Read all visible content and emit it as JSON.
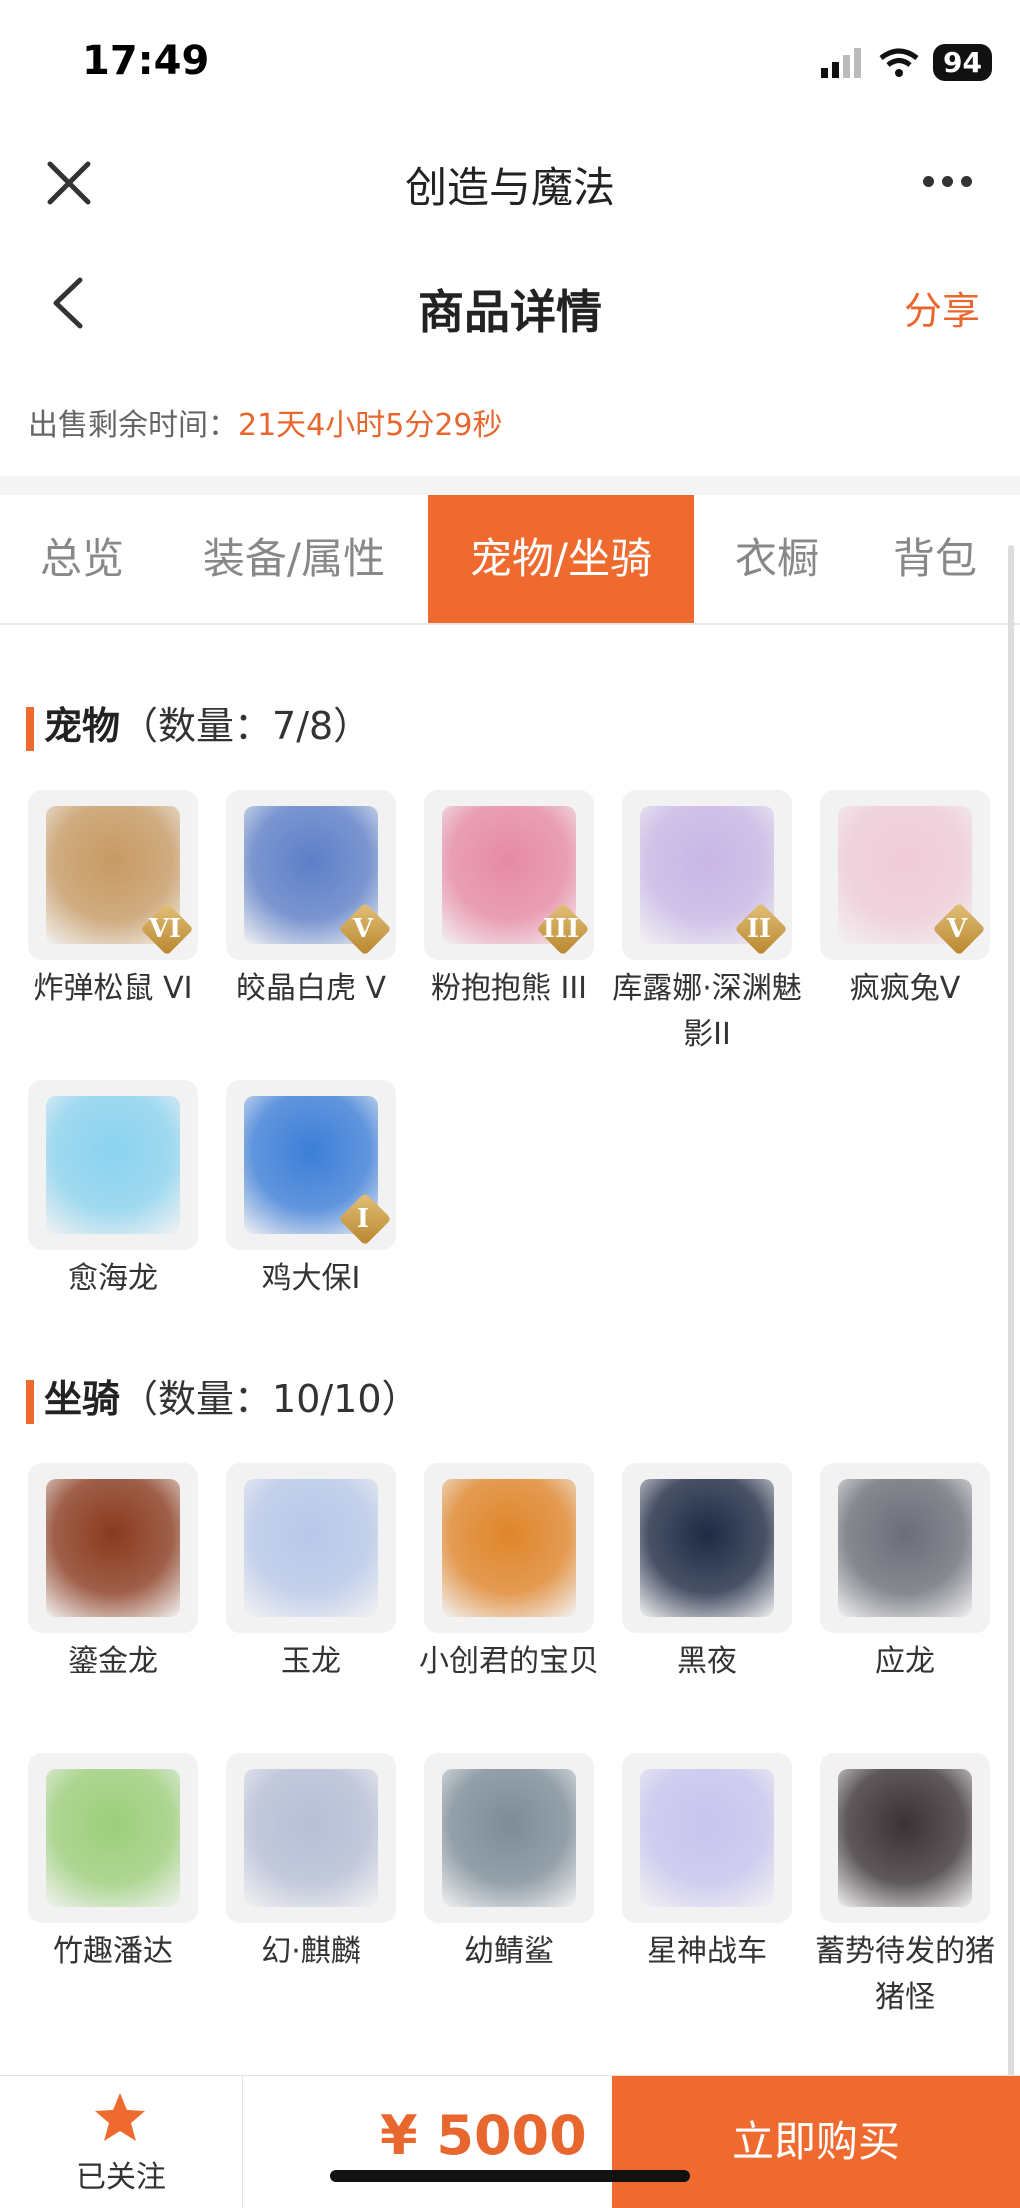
{
  "status": {
    "time": "17:49",
    "battery": "94"
  },
  "appbar": {
    "title": "创造与魔法"
  },
  "navbar": {
    "title": "商品详情",
    "share": "分享"
  },
  "timer": {
    "label": "出售剩余时间：",
    "value": "21天4小时5分29秒"
  },
  "tabs": [
    "总览",
    "装备/属性",
    "宠物/坐骑",
    "衣橱",
    "背包"
  ],
  "active_tab": "宠物/坐骑",
  "pets": {
    "title": "宠物",
    "count": "（数量：7/8）",
    "items": [
      {
        "name": "炸弹松鼠 VI",
        "rank": "VI",
        "color": "#c79a63"
      },
      {
        "name": "皎晶白虎 V",
        "rank": "V",
        "color": "#5d7fc8"
      },
      {
        "name": "粉抱抱熊 III",
        "rank": "III",
        "color": "#e78aa6"
      },
      {
        "name": "库露娜·深渊魅影II",
        "rank": "II",
        "color": "#c8b6e6"
      },
      {
        "name": "疯疯兔V",
        "rank": "V",
        "color": "#f0cbd8"
      },
      {
        "name": "愈海龙",
        "rank": "",
        "color": "#8ad3f0"
      },
      {
        "name": "鸡大保I",
        "rank": "I",
        "color": "#3c7ed8"
      }
    ]
  },
  "mounts": {
    "title": "坐骑",
    "count": "（数量：10/10）",
    "items": [
      {
        "name": "鎏金龙",
        "color": "#8a3a1e"
      },
      {
        "name": "玉龙",
        "color": "#b8c8ea"
      },
      {
        "name": "小创君的宝贝",
        "color": "#e0852a"
      },
      {
        "name": "黑夜",
        "color": "#1e2a44"
      },
      {
        "name": "应龙",
        "color": "#6b6e78"
      },
      {
        "name": "竹趣潘达",
        "color": "#9ccf7a"
      },
      {
        "name": "幻·麒麟",
        "color": "#b6bfd6"
      },
      {
        "name": "幼鲭鲨",
        "color": "#7c8c98"
      },
      {
        "name": "星神战车",
        "color": "#c7c4ef"
      },
      {
        "name": "蓄势待发的猪猪怪",
        "color": "#3a3234"
      }
    ]
  },
  "bottom": {
    "follow_label": "已关注",
    "price": "¥ 5000",
    "buy_label": "立即购买"
  },
  "colors": {
    "accent": "#ee6a2e",
    "accent_text": "#e8672f"
  }
}
